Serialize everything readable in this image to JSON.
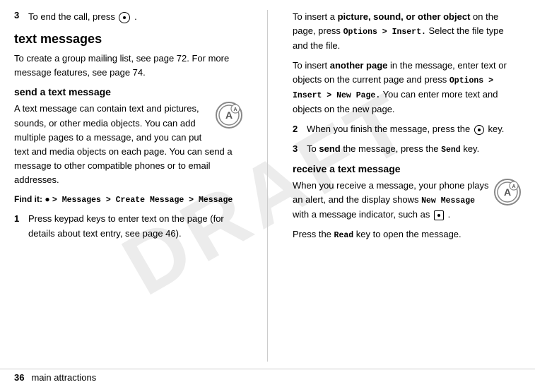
{
  "watermark": "DRAFT",
  "footer": {
    "page_number": "36",
    "label": "main attractions"
  },
  "left_column": {
    "step3": {
      "num": "3",
      "text_before": "To end the call, press",
      "text_after": "."
    },
    "section_heading": "text messages",
    "intro_text": "To create a group mailing list, see page 72. For more message features, see page 74.",
    "subsection_heading": "send a text message",
    "body_text": "A text message can contain text and pictures, sounds, or other media objects. You can add multiple pages to a message, and you can put text and media objects on each page. You can send a message to other compatible phones or to email addresses.",
    "find_it_label": "Find it:",
    "find_it_path": "> Messages > Create Message > Message",
    "steps": [
      {
        "num": "1",
        "text": "Press keypad keys to enter text on the page (for details about text entry, see page 46)."
      }
    ]
  },
  "right_column": {
    "insert_picture_text_before": "To insert a",
    "insert_picture_bold": "picture, sound, or other object",
    "insert_picture_text_after": "on the page, press",
    "insert_picture_menu": "Options > Insert.",
    "insert_picture_rest": "Select the file type and the file.",
    "another_page_before": "To insert",
    "another_page_bold": "another page",
    "another_page_after": "in the message, enter text or objects on the current page and press",
    "another_page_menu": "Options > Insert > New Page.",
    "another_page_rest": "You can enter more text and objects on the new page.",
    "steps": [
      {
        "num": "2",
        "text_before": "When you finish the message, press the",
        "text_after": "key."
      },
      {
        "num": "3",
        "text_before": "To",
        "bold": "send",
        "text_middle": "the message, press the",
        "menu": "Send",
        "text_end": "key."
      }
    ],
    "receive_heading": "receive a text message",
    "receive_body_before": "When you receive a message, your phone plays an alert, and the display shows",
    "receive_bold": "New Message",
    "receive_middle": "with a message indicator, such as",
    "receive_after": ".",
    "read_text": "Press the",
    "read_menu": "Read",
    "read_after": "key to open the message."
  }
}
